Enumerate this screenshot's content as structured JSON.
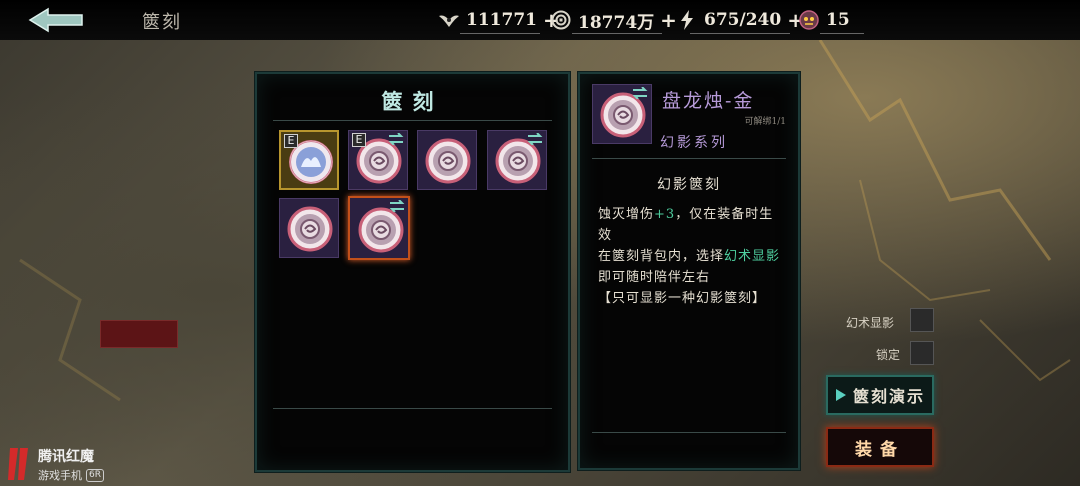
{
  "header": {
    "title": "篋刻",
    "resources": [
      {
        "icon": "wings-crest-icon",
        "value": "111771",
        "has_plus": true
      },
      {
        "icon": "coin-icon",
        "value": "18774万",
        "has_plus": true
      },
      {
        "icon": "lightning-icon",
        "value": "675/240",
        "has_plus": true
      },
      {
        "icon": "demon-mask-icon",
        "value": "15",
        "has_plus": false
      }
    ]
  },
  "sidebar": {
    "items": [
      {
        "label": ""
      },
      {
        "label": ""
      },
      {
        "label": ""
      },
      {
        "label": ""
      },
      {
        "label": ""
      }
    ]
  },
  "inventory": {
    "title": "篋刻",
    "slots": [
      {
        "equipped": true,
        "swap": false,
        "quality": "gold",
        "selected": false
      },
      {
        "equipped": true,
        "swap": true,
        "quality": "purple",
        "selected": false
      },
      {
        "equipped": false,
        "swap": false,
        "quality": "purple",
        "selected": false
      },
      {
        "equipped": false,
        "swap": true,
        "quality": "purple",
        "selected": false
      },
      {
        "equipped": false,
        "swap": false,
        "quality": "purple",
        "selected": false
      },
      {
        "equipped": false,
        "swap": true,
        "quality": "purple",
        "selected": true
      }
    ],
    "equipped_badge": "E"
  },
  "detail": {
    "name": "盘龙烛-金",
    "unbind": "可解绑1/1",
    "series": "幻影系列",
    "heading": "幻影篋刻",
    "line1_pre": "蚀灭增伤",
    "line1_value": "+3",
    "line1_post": "，仅在装备时生效",
    "line2_pre": "在篋刻背包内，选择",
    "line2_highlight": "幻术显影",
    "line2_post": "即可随时陪伴左右",
    "line3": "【只可显影一种幻影篋刻】"
  },
  "options": {
    "phantom_label": "幻术显影",
    "lock_label": "锁定"
  },
  "buttons": {
    "demo_label": "篋刻演示",
    "equip_label": "装备"
  },
  "watermark": {
    "brand": "腾讯红魔",
    "model": "游戏手机",
    "model_tag": "6R"
  },
  "colors": {
    "accent_teal": "#bfe8e2",
    "rarity_purple": "#b69ad8",
    "highlight_green": "#4fd0a0",
    "selected_orange": "#c2501a"
  }
}
